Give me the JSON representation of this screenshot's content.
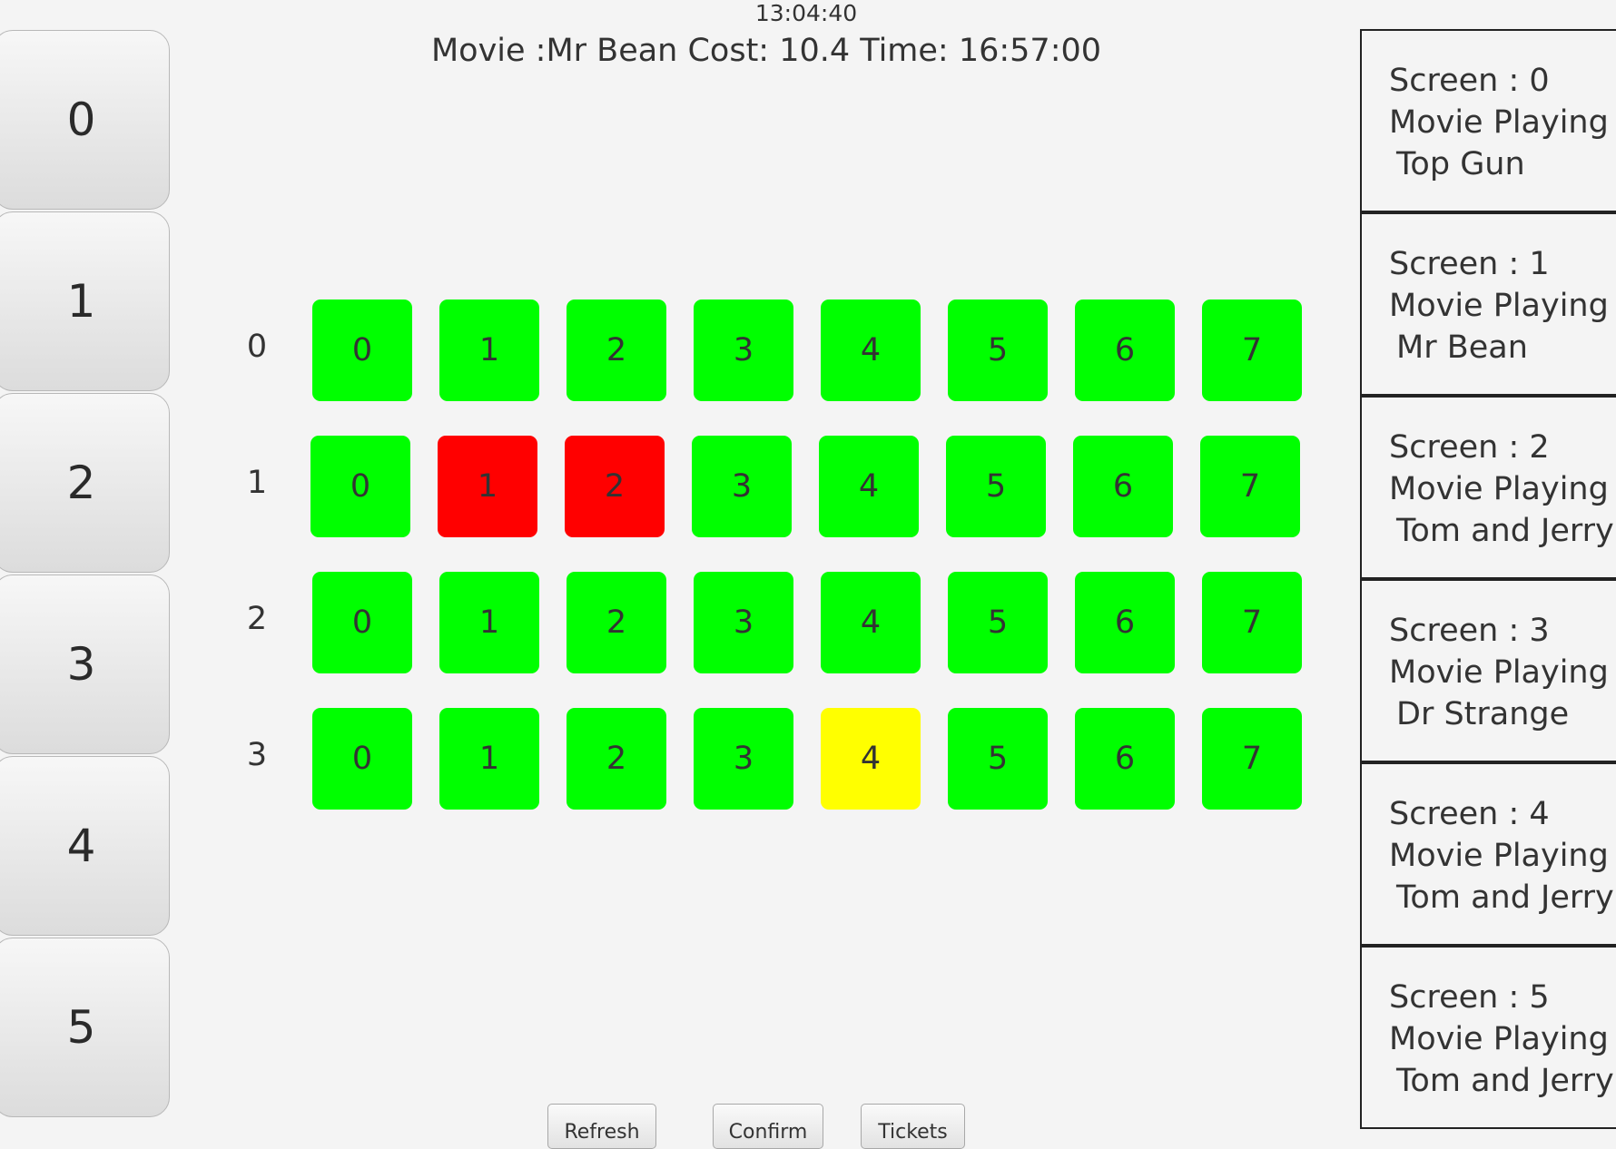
{
  "clock": "13:04:40",
  "title": "Movie :Mr Bean Cost: 10.4 Time: 16:57:00",
  "screen_buttons": [
    "0",
    "1",
    "2",
    "3",
    "4",
    "5"
  ],
  "seating": {
    "column_labels": [
      "0",
      "1",
      "2",
      "3",
      "4",
      "5",
      "6",
      "7"
    ],
    "rows": [
      {
        "label": "0",
        "seats": [
          {
            "label": "0",
            "status": "available"
          },
          {
            "label": "1",
            "status": "available"
          },
          {
            "label": "2",
            "status": "available"
          },
          {
            "label": "3",
            "status": "available"
          },
          {
            "label": "4",
            "status": "available"
          },
          {
            "label": "5",
            "status": "available"
          },
          {
            "label": "6",
            "status": "available"
          },
          {
            "label": "7",
            "status": "available"
          }
        ]
      },
      {
        "label": "1",
        "seats": [
          {
            "label": "0",
            "status": "available"
          },
          {
            "label": "1",
            "status": "booked"
          },
          {
            "label": "2",
            "status": "booked"
          },
          {
            "label": "3",
            "status": "available"
          },
          {
            "label": "4",
            "status": "available"
          },
          {
            "label": "5",
            "status": "available"
          },
          {
            "label": "6",
            "status": "available"
          },
          {
            "label": "7",
            "status": "available"
          }
        ]
      },
      {
        "label": "2",
        "seats": [
          {
            "label": "0",
            "status": "available"
          },
          {
            "label": "1",
            "status": "available"
          },
          {
            "label": "2",
            "status": "available"
          },
          {
            "label": "3",
            "status": "available"
          },
          {
            "label": "4",
            "status": "available"
          },
          {
            "label": "5",
            "status": "available"
          },
          {
            "label": "6",
            "status": "available"
          },
          {
            "label": "7",
            "status": "available"
          }
        ]
      },
      {
        "label": "3",
        "seats": [
          {
            "label": "0",
            "status": "available"
          },
          {
            "label": "1",
            "status": "available"
          },
          {
            "label": "2",
            "status": "available"
          },
          {
            "label": "3",
            "status": "available"
          },
          {
            "label": "4",
            "status": "selected"
          },
          {
            "label": "5",
            "status": "available"
          },
          {
            "label": "6",
            "status": "available"
          },
          {
            "label": "7",
            "status": "available"
          }
        ]
      }
    ]
  },
  "colors": {
    "available": "#00ff00",
    "booked": "#ff0000",
    "selected": "#ffff00"
  },
  "screens": [
    {
      "screen": "Screen : 0",
      "playing": "Movie Playing :",
      "movie": "Top Gun"
    },
    {
      "screen": "Screen : 1",
      "playing": "Movie Playing :",
      "movie": "Mr Bean"
    },
    {
      "screen": "Screen : 2",
      "playing": "Movie Playing :",
      "movie": "Tom and Jerry"
    },
    {
      "screen": "Screen : 3",
      "playing": "Movie Playing :",
      "movie": "Dr Strange"
    },
    {
      "screen": "Screen : 4",
      "playing": "Movie Playing :",
      "movie": "Tom and Jerry"
    },
    {
      "screen": "Screen : 5",
      "playing": "Movie Playing :",
      "movie": "Tom and Jerry"
    }
  ],
  "actions": {
    "refresh": "Refresh",
    "confirm": "Confirm",
    "tickets": "Tickets"
  }
}
